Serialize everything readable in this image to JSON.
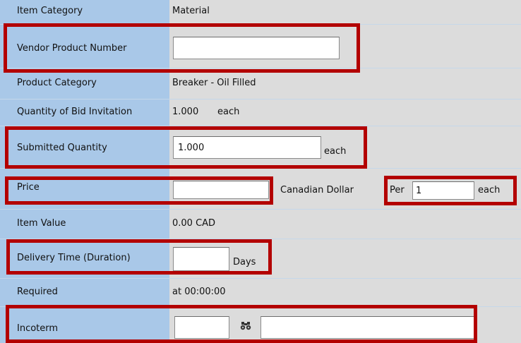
{
  "rows": {
    "item_category": {
      "label": "Item Category",
      "value": "Material"
    },
    "vendor_product_number": {
      "label": "Vendor Product Number",
      "value": ""
    },
    "product_category": {
      "label": "Product Category",
      "value": "Breaker - Oil Filled"
    },
    "quantity_bid_invitation": {
      "label": "Quantity of Bid Invitation",
      "value": "1.000",
      "unit": "each"
    },
    "submitted_quantity": {
      "label": "Submitted Quantity",
      "value": "1.000",
      "unit": "each"
    },
    "price": {
      "label": "Price",
      "value": "",
      "currency": "Canadian Dollar",
      "per_label": "Per",
      "per_value": "1",
      "per_unit": "each"
    },
    "item_value": {
      "label": "Item Value",
      "value": "0.00 CAD"
    },
    "delivery_time": {
      "label": "Delivery Time (Duration)",
      "value": "",
      "unit": "Days"
    },
    "required": {
      "label": "Required",
      "value": "at 00:00:00"
    },
    "incoterm": {
      "label": "Incoterm",
      "value": "",
      "search_icon": "binoculars-icon",
      "location_value": ""
    }
  },
  "colors": {
    "label_bg": "#a9c8e8",
    "value_bg": "#dcdcdc",
    "highlight": "#b30000"
  }
}
